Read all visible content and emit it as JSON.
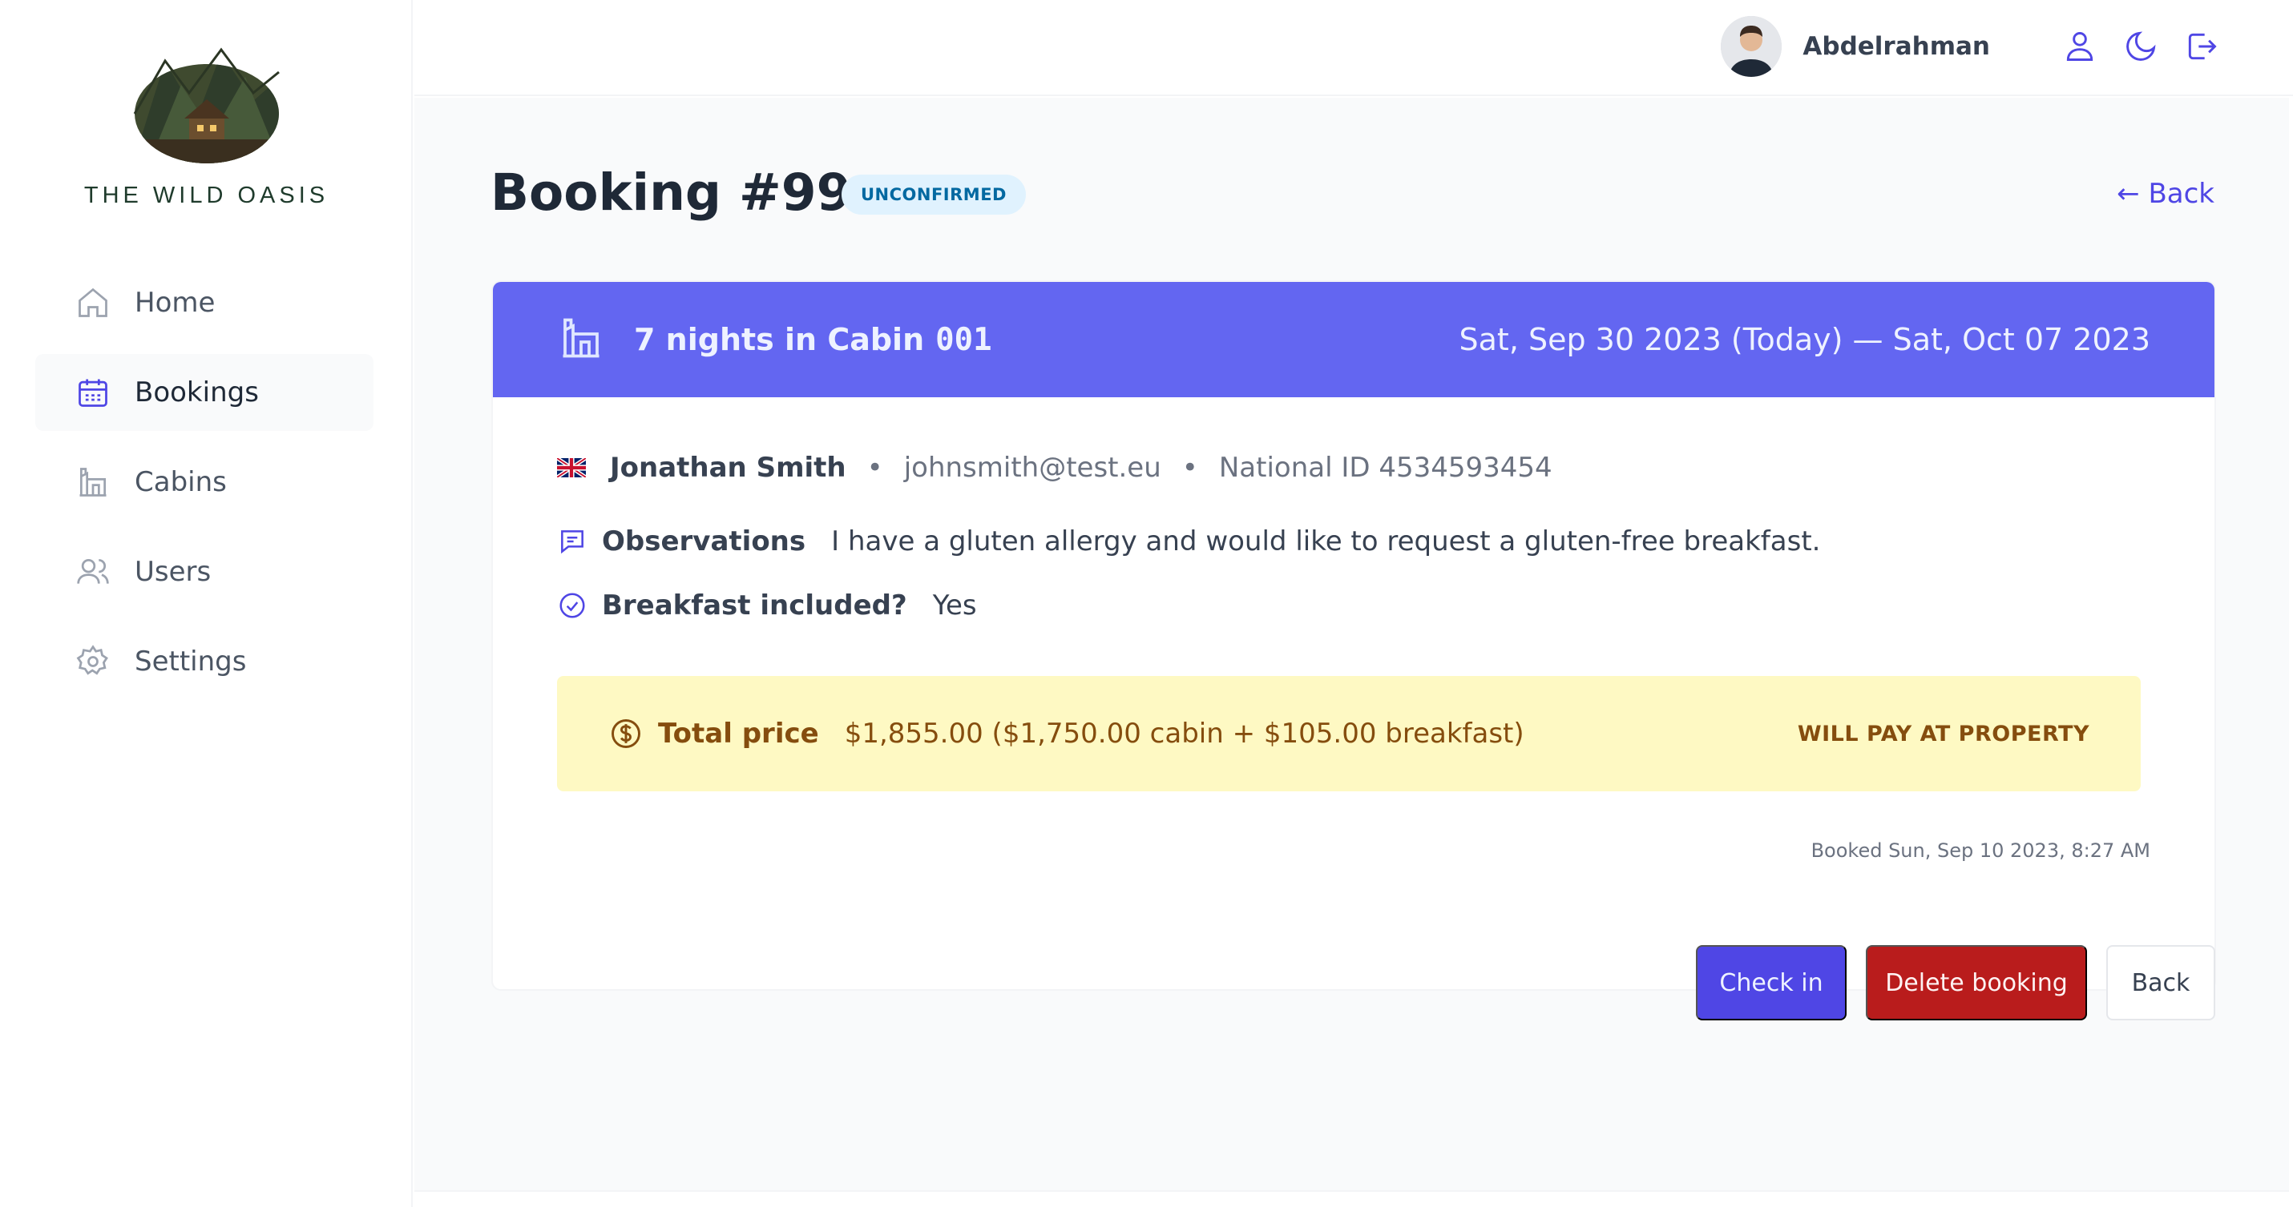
{
  "app": {
    "name": "THE WILD OASIS"
  },
  "sidebar": {
    "items": [
      {
        "label": "Home",
        "icon": "home-icon",
        "active": false
      },
      {
        "label": "Bookings",
        "icon": "calendar-icon",
        "active": true
      },
      {
        "label": "Cabins",
        "icon": "cabin-icon",
        "active": false
      },
      {
        "label": "Users",
        "icon": "users-icon",
        "active": false
      },
      {
        "label": "Settings",
        "icon": "gear-icon",
        "active": false
      }
    ]
  },
  "header": {
    "user_name": "Abdelrahman",
    "icons": [
      "user-icon",
      "moon-icon",
      "logout-icon"
    ]
  },
  "booking": {
    "title": "Booking #99",
    "status": "UNCONFIRMED",
    "back_link": "← Back",
    "nights_text": "7 nights in Cabin",
    "cabin_name": "001",
    "dates": "Sat, Sep 30 2023 (Today) — Sat, Oct 07 2023",
    "guest": {
      "name": "Jonathan Smith",
      "email": "johnsmith@test.eu",
      "national_id": "National ID 4534593454",
      "country_flag": "uk-flag-icon"
    },
    "observations_label": "Observations",
    "observations": "I have a gluten allergy and would like to request a gluten-free breakfast.",
    "breakfast_label": "Breakfast included?",
    "breakfast_value": "Yes",
    "price_label": "Total price",
    "price_value": "$1,855.00 ($1,750.00 cabin + $105.00 breakfast)",
    "payment_status": "WILL PAY AT PROPERTY",
    "booked_at": "Booked Sun, Sep 10 2023, 8:27 AM"
  },
  "actions": {
    "check_in": "Check in",
    "delete": "Delete booking",
    "back": "Back"
  },
  "colors": {
    "accent": "#4f46e5",
    "header_band": "#6366f1",
    "price_bg": "#fef9c3",
    "price_text": "#854d0e",
    "danger": "#b91c1c",
    "badge_bg": "#e0f2fe",
    "badge_text": "#0369a1"
  }
}
